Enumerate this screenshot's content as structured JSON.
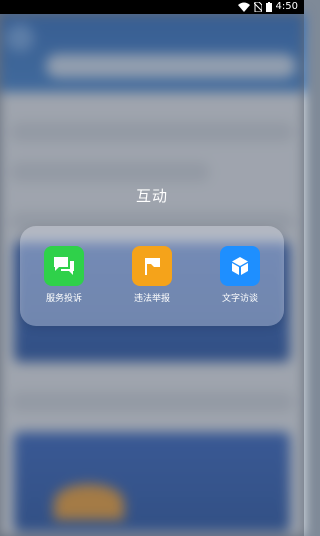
{
  "status_bar": {
    "time": "4:50",
    "icons": [
      "wifi-icon",
      "no-sim-icon",
      "battery-icon"
    ]
  },
  "folder": {
    "title": "互动",
    "apps": [
      {
        "label": "服务投诉",
        "icon": "chat-bubbles-icon",
        "color": "#2fd14a"
      },
      {
        "label": "违法举报",
        "icon": "flag-icon",
        "color": "#f5a31a"
      },
      {
        "label": "文字访谈",
        "icon": "cube-icon",
        "color": "#1e8fff"
      }
    ]
  }
}
